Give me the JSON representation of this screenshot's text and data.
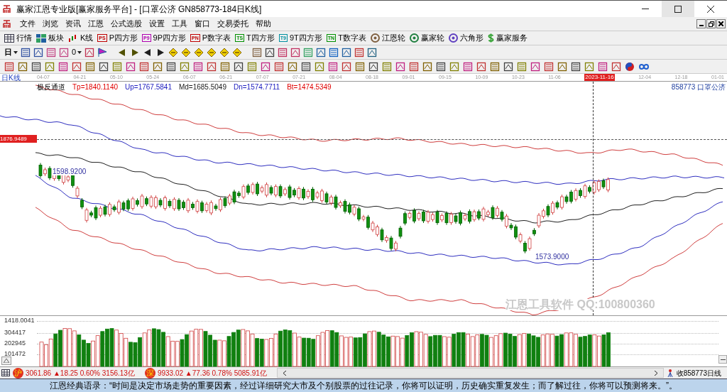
{
  "window": {
    "title": "赢家江恩专业版[赢家服务平台] - [口罩公济  GN858773-184日K线]"
  },
  "menu": [
    "文件",
    "浏览",
    "资讯",
    "江恩",
    "公式选股",
    "设置",
    "工具",
    "窗口",
    "交易委托",
    "帮助"
  ],
  "toolbar": [
    {
      "kind": "grid",
      "label": "行情"
    },
    {
      "kind": "blocks",
      "label": "板块"
    },
    {
      "kind": "candles",
      "label": "K线"
    },
    {
      "kind": "badge",
      "badge": "PS",
      "color": "#c00000",
      "label": "P四方形"
    },
    {
      "kind": "badge",
      "badge": "P9",
      "color": "#b000b0",
      "label": "9P四方形"
    },
    {
      "kind": "badge",
      "badge": "PN",
      "color": "#c00000",
      "label": "P数字表"
    },
    {
      "kind": "badge",
      "badge": "TS",
      "color": "#009000",
      "label": "T四方形"
    },
    {
      "kind": "badge",
      "badge": "T9",
      "color": "#0090a0",
      "label": "9T四方形"
    },
    {
      "kind": "badge",
      "badge": "TN",
      "color": "#009000",
      "label": "T数字表"
    },
    {
      "kind": "wheel",
      "color": "#806040",
      "label": "江恩轮"
    },
    {
      "kind": "wheel",
      "color": "#208040",
      "label": "赢家轮"
    },
    {
      "kind": "wheel",
      "color": "#6040c0",
      "label": "六角形"
    },
    {
      "kind": "dollar",
      "label": "赢家服务"
    }
  ],
  "period_dropdown": "日",
  "count_dropdown": "0",
  "date_axis": {
    "ticks": [
      {
        "label": "04-07",
        "selected": false
      },
      {
        "label": "04-21",
        "selected": false
      },
      {
        "label": "05-10",
        "selected": false
      },
      {
        "label": "05-24",
        "selected": false
      },
      {
        "label": "06-07",
        "selected": false
      },
      {
        "label": "06-21",
        "selected": false
      },
      {
        "label": "07-07",
        "selected": false
      },
      {
        "label": "07-21",
        "selected": false
      },
      {
        "label": "08-04",
        "selected": false
      },
      {
        "label": "08-18",
        "selected": false
      },
      {
        "label": "09-01",
        "selected": false
      },
      {
        "label": "09-15",
        "selected": false
      },
      {
        "label": "10-09",
        "selected": false
      },
      {
        "label": "10-23",
        "selected": false
      },
      {
        "label": "11-06",
        "selected": false
      },
      {
        "label": "2023-11-16",
        "selected": true
      },
      {
        "label": "12-04",
        "selected": false
      },
      {
        "label": "12-18",
        "selected": false
      },
      {
        "label": "01-01",
        "selected": false
      }
    ]
  },
  "chart": {
    "period": "日K线",
    "indicator": "极反通道",
    "values": [
      {
        "text": "Tp=1840.1140",
        "color": "#e00000"
      },
      {
        "text": "Up=1767.5841",
        "color": "#2020c0"
      },
      {
        "text": "Md=1685.5049",
        "color": "#202020"
      },
      {
        "text": "Dn=1574.7711",
        "color": "#2020c0"
      },
      {
        "text": "Bt=1474.5349",
        "color": "#e00000"
      }
    ],
    "stock": "858773  口罩公济",
    "cursor_price": "1876.9489",
    "high_label": "1598.9200",
    "low_label": "1573.9000",
    "caption": "江恩工具软件   QQ:100800360"
  },
  "volume": {
    "labels": [
      "1418.0041",
      "304417",
      "202945",
      "101472"
    ]
  },
  "status_bar": {
    "indices": [
      {
        "badge": "沪",
        "text": "3061.86 ▲18.25 0.60% 3156.13亿"
      },
      {
        "badge": "深",
        "text": "9933.02 ▲77.36 0.78% 5085.91亿"
      }
    ],
    "right": "收858773日线"
  },
  "quote": "江恩经典语录：“时间是决定市场走势的重要因素，经过详细研究大市及个别股票的过往记录，你将可以证明，历史确实重复发生；而了解过往，你将可以预测将来。”。"
}
